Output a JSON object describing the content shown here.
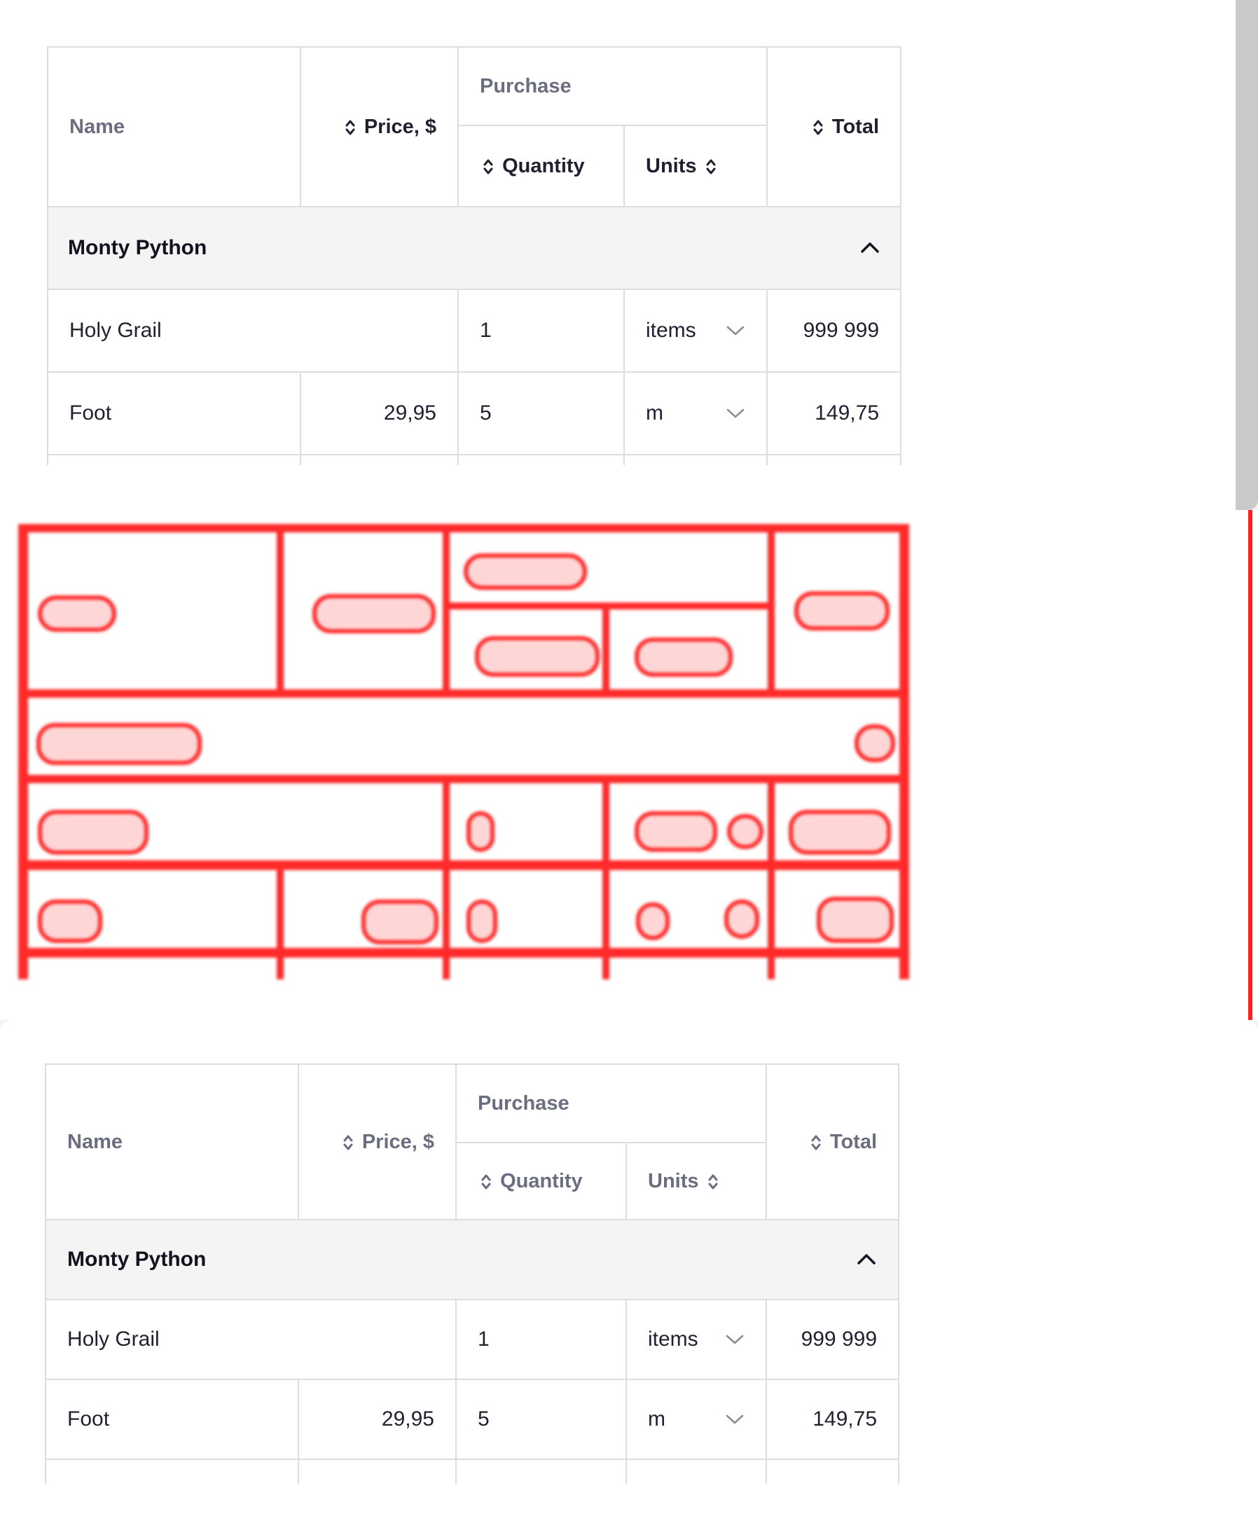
{
  "table": {
    "headers": {
      "name": "Name",
      "price": "Price, $",
      "purchase": "Purchase",
      "quantity": "Quantity",
      "units": "Units",
      "total": "Total"
    },
    "group": {
      "label": "Monty Python"
    },
    "rows": [
      {
        "name": "Holy Grail",
        "price": "",
        "quantity": "1",
        "units": "items",
        "total": "999 999"
      },
      {
        "name": "Foot",
        "price": "29,95",
        "quantity": "5",
        "units": "m",
        "total": "149,75"
      }
    ]
  },
  "icons": {
    "sort": "sort-updown-icon",
    "collapse": "chevron-up-icon",
    "dropdown": "chevron-down-icon"
  },
  "colors": {
    "border": "#dcdde1",
    "group_bg": "#f4f4f5",
    "text": "#1f2130",
    "muted_text": "#6b6e7e",
    "diff_red": "#ff2a2a",
    "scrollbar": "#c9c9cc"
  }
}
